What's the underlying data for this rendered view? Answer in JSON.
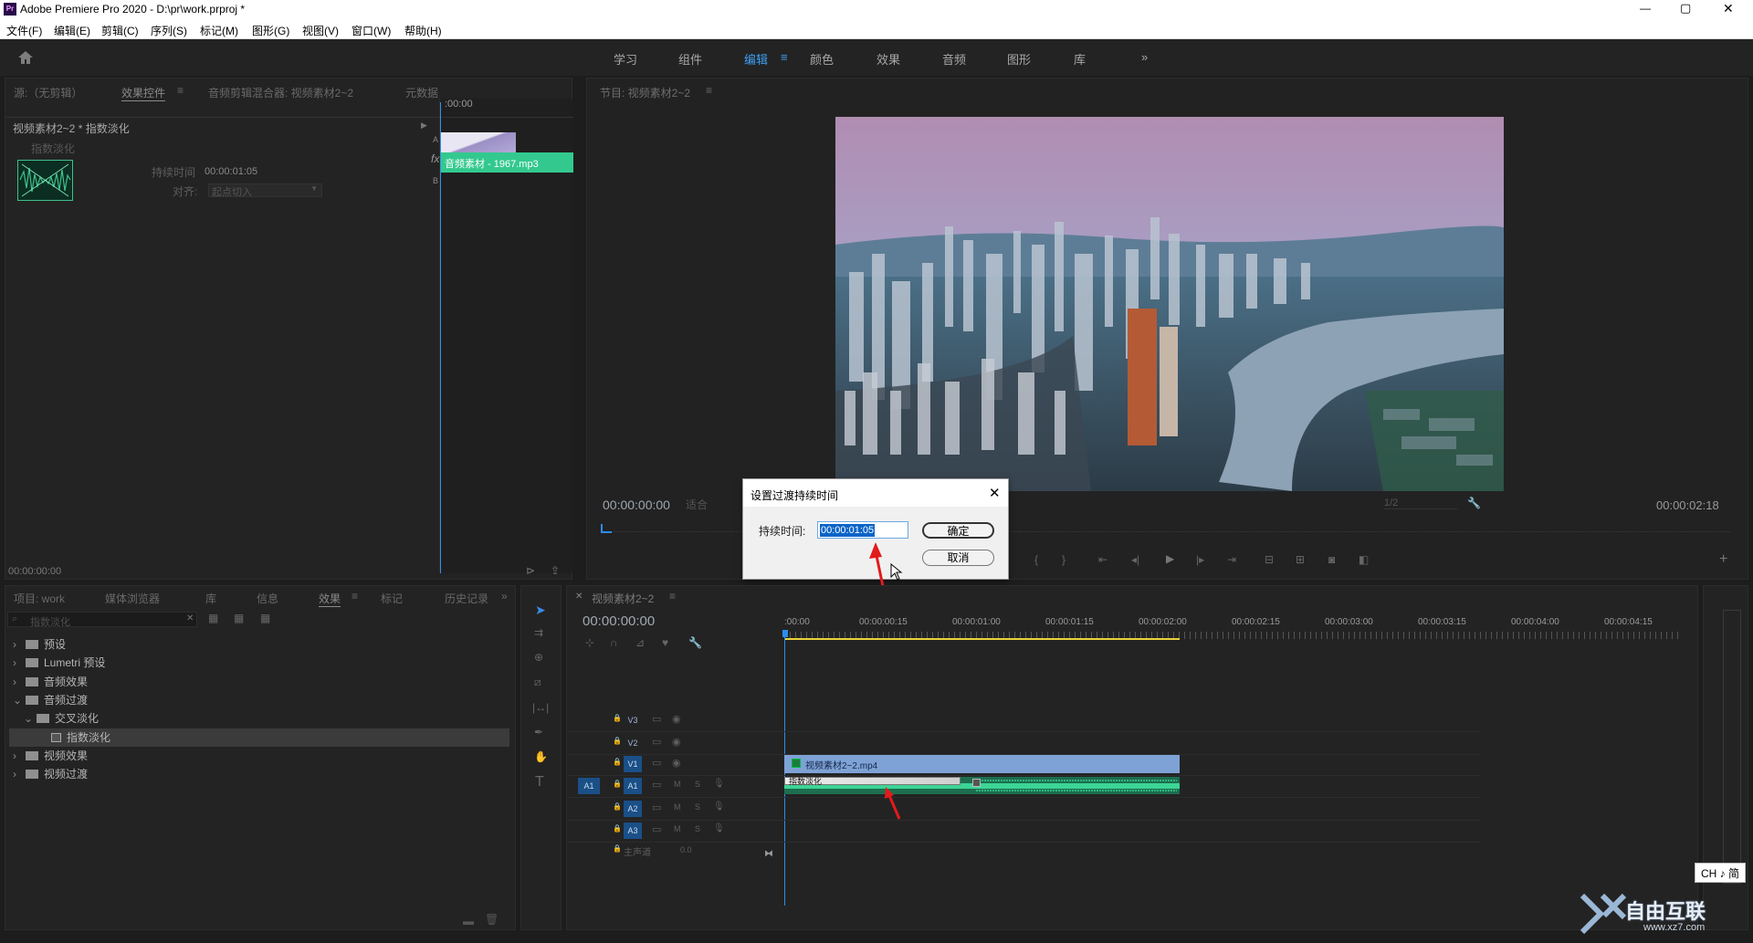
{
  "app": {
    "title": "Adobe Premiere Pro 2020 - D:\\pr\\work.prproj *",
    "logo": "Pr"
  },
  "window_controls": [
    "—",
    "▢",
    "✕"
  ],
  "menu": [
    "文件(F)",
    "编辑(E)",
    "剪辑(C)",
    "序列(S)",
    "标记(M)",
    "图形(G)",
    "视图(V)",
    "窗口(W)",
    "帮助(H)"
  ],
  "workspaces": [
    "学习",
    "组件",
    "编辑",
    "颜色",
    "效果",
    "音频",
    "图形",
    "库"
  ],
  "workspace_active": "编辑",
  "source_tabs": [
    "源:（无剪辑）",
    "效果控件",
    "音频剪辑混合器: 视频素材2~2",
    "元数据"
  ],
  "effect_controls": {
    "clip": "视频素材2~2 * 指数淡化",
    "effect_name": "指数淡化",
    "duration_label": "持续时间",
    "duration_value": "00:00:01:05",
    "align_label": "对齐:",
    "align_value": "起点切入",
    "ruler_time": ":00:00",
    "track_a": "A",
    "track_b": "B",
    "fx": "fx",
    "clip_label": "音频素材 - 1967.mp3",
    "footer_time": "00:00:00:00"
  },
  "program": {
    "tab": "节目: 视频素材2~2",
    "timecode_left": "00:00:00:00",
    "fit": "适合",
    "quality": "1/2",
    "timecode_right": "00:00:02:18"
  },
  "dialog": {
    "title": "设置过渡持续时间",
    "label": "持续时间:",
    "value": "00:00:01:05",
    "ok": "确定",
    "cancel": "取消"
  },
  "project_tabs": [
    "项目: work",
    "媒体浏览器",
    "库",
    "信息",
    "效果",
    "标记",
    "历史记录"
  ],
  "search_placeholder": "指数淡化",
  "effects_tree": [
    {
      "label": "预设",
      "level": 0,
      "expanded": false
    },
    {
      "label": "Lumetri 预设",
      "level": 0,
      "expanded": false
    },
    {
      "label": "音频效果",
      "level": 0,
      "expanded": false
    },
    {
      "label": "音频过渡",
      "level": 0,
      "expanded": true
    },
    {
      "label": "交叉淡化",
      "level": 1,
      "expanded": true
    },
    {
      "label": "指数淡化",
      "level": 2,
      "selected": true
    },
    {
      "label": "视频效果",
      "level": 0,
      "expanded": false
    },
    {
      "label": "视频过渡",
      "level": 0,
      "expanded": false
    }
  ],
  "timeline": {
    "tab": "视频素材2~2",
    "timecode": "00:00:00:00",
    "ruler": [
      ":00:00",
      "00:00:00:15",
      "00:00:01:00",
      "00:00:01:15",
      "00:00:02:00",
      "00:00:02:15",
      "00:00:03:00",
      "00:00:03:15",
      "00:00:04:00",
      "00:00:04:15"
    ],
    "tracks": [
      "V3",
      "V2",
      "V1",
      "A1",
      "A2",
      "A3"
    ],
    "src_track": "A1",
    "master": "主声道",
    "master_val": "0.0",
    "mute": "M",
    "solo": "S",
    "video_clip": "视频素材2~2.mp4",
    "transition": "指数淡化"
  },
  "ime": "CH ♪ 简",
  "watermark": {
    "brand": "自由互联",
    "url": "www.xz7.com"
  },
  "colors": {
    "accent": "#2d8ceb",
    "clip_video": "#7ea2d5",
    "clip_audio": "#2fbf87",
    "selection": "#1a4f87"
  }
}
